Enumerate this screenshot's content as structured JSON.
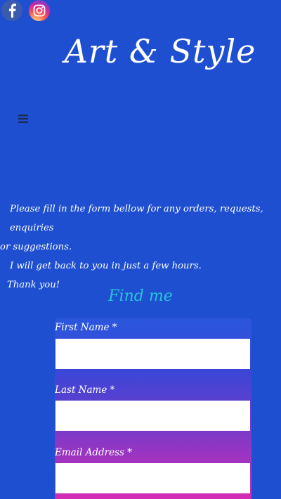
{
  "social": {
    "facebook_icon": "facebook-icon",
    "instagram_icon": "instagram-icon"
  },
  "brand": {
    "title": "Art & Style"
  },
  "nav": {
    "menu_icon": "hamburger-menu-icon"
  },
  "intro": {
    "line1": "Please fill in the form bellow for any orders, requests, enquiries",
    "line2": "or suggestions.",
    "line3": "I will get back to you in just a few hours.",
    "line4": "Thank you!"
  },
  "form": {
    "title": "Find me",
    "fields": [
      {
        "label": "First Name *",
        "value": "",
        "placeholder": ""
      },
      {
        "label": "Last Name *",
        "value": "",
        "placeholder": ""
      },
      {
        "label": "Email Address *",
        "value": "",
        "placeholder": ""
      }
    ]
  },
  "colors": {
    "background": "#1f4fd1",
    "accent_title": "#29c3d8",
    "form_gradient_top": "#2b56dd",
    "form_gradient_bottom": "#d52bb4"
  }
}
